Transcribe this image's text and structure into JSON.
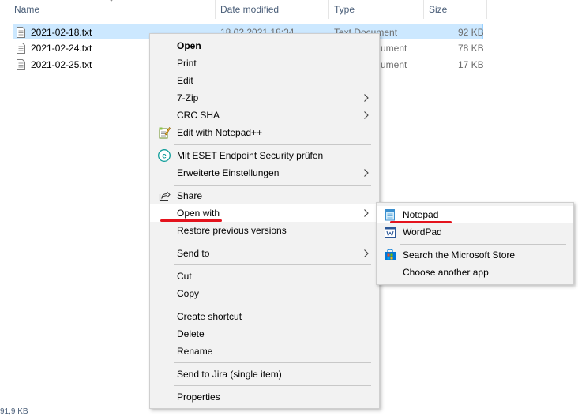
{
  "columns": {
    "name": "Name",
    "date_modified": "Date modified",
    "type": "Type",
    "size": "Size"
  },
  "files": [
    {
      "name": "2021-02-18.txt",
      "date": "18.02.2021 18:34",
      "type": "Text Document",
      "size": "92 KB",
      "selected": true
    },
    {
      "name": "2021-02-24.txt",
      "date": "",
      "type": "ument",
      "size": "78 KB",
      "selected": false
    },
    {
      "name": "2021-02-25.txt",
      "date": "",
      "type": "ument",
      "size": "17 KB",
      "selected": false
    }
  ],
  "status_bar": "91,9 KB",
  "context_menu": {
    "items": {
      "open": "Open",
      "print": "Print",
      "edit": "Edit",
      "seven_zip": "7-Zip",
      "crc_sha": "CRC SHA",
      "edit_notepadpp": "Edit with Notepad++",
      "eset_scan": "Mit ESET Endpoint Security prüfen",
      "eset_advanced": "Erweiterte Einstellungen",
      "share": "Share",
      "open_with": "Open with",
      "restore_versions": "Restore previous versions",
      "send_to": "Send to",
      "cut": "Cut",
      "copy": "Copy",
      "create_shortcut": "Create shortcut",
      "delete": "Delete",
      "rename": "Rename",
      "send_to_jira": "Send to Jira (single item)",
      "properties": "Properties"
    }
  },
  "open_with_submenu": {
    "notepad": "Notepad",
    "wordpad": "WordPad",
    "ms_store": "Search the Microsoft Store",
    "choose_app": "Choose another app"
  },
  "colors": {
    "selection_bg": "#cce8ff",
    "menu_bg": "#f2f2f2",
    "highlight_mark": "#e4131d"
  },
  "icons": {
    "file": "text-file-icon",
    "notepadpp": "notepad-plus-plus-icon",
    "eset": "eset-icon",
    "share": "share-icon",
    "notepad": "notepad-icon",
    "wordpad": "wordpad-icon",
    "store": "microsoft-store-icon",
    "submenu": "chevron-right-icon"
  }
}
